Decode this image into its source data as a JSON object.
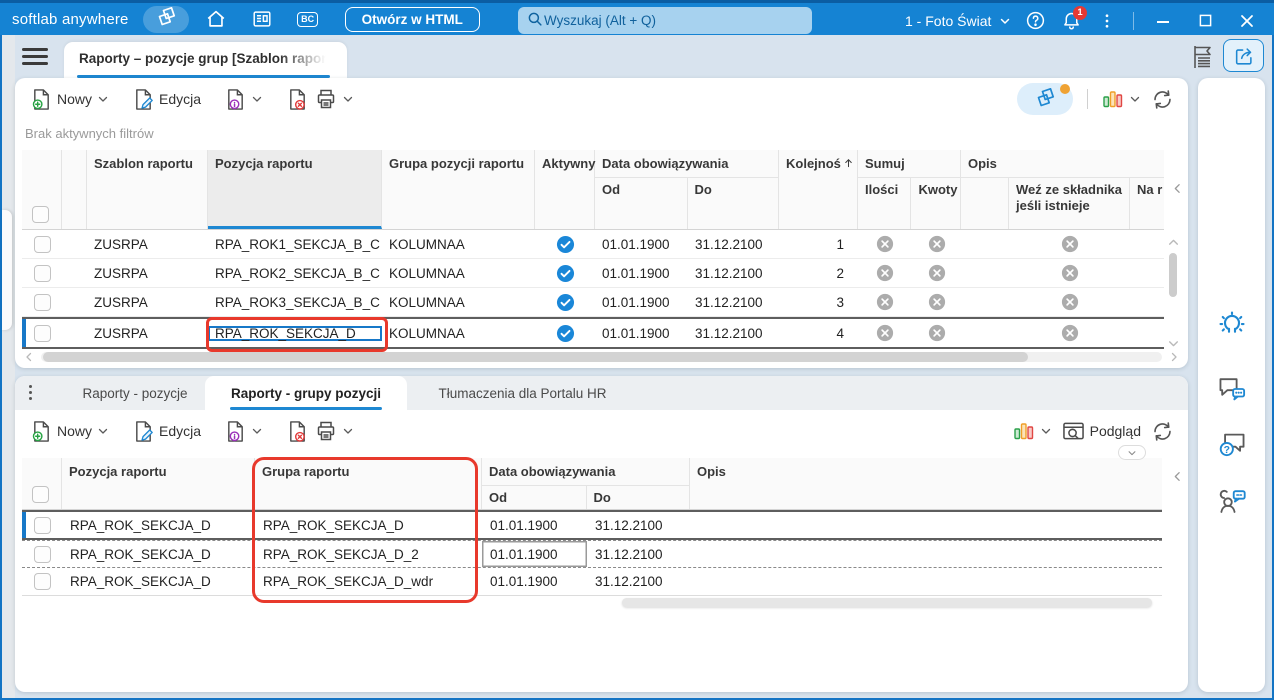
{
  "colors": {
    "titlebar_blue": "#1583d3",
    "accent_blue": "#1e88d2",
    "annotation_red": "#e8392c",
    "active_check_blue": "#1a87d8",
    "disabled_gray": "#acacac"
  },
  "titlebar": {
    "brand": "softlab anywhere",
    "bc_label": "BC",
    "open_html_button": "Otwórz w HTML",
    "search_placeholder": "Wyszukaj (Alt + Q)",
    "company_selector": "1 - Foto Świat",
    "notification_count": "1"
  },
  "workspace_tab": {
    "title": "Raporty – pozycje grup [Szablon rapor"
  },
  "top_toolbar": {
    "new": "Nowy",
    "edit": "Edycja"
  },
  "filter_status": "Brak aktywnych filtrów",
  "top_grid": {
    "columns": {
      "template": "Szablon raportu",
      "position": "Pozycja raportu",
      "group": "Grupa pozycji raportu",
      "active": "Aktywny",
      "validity": "Data obowiązywania",
      "from": "Od",
      "to": "Do",
      "order": "Kolejnoś",
      "sum": "Sumuj",
      "quantities": "Ilości",
      "amounts": "Kwoty",
      "description": "Opis",
      "take_from_component": "Weź ze składnika jeśli istnieje",
      "na_r": "Na r"
    },
    "rows": [
      {
        "template": "ZUSRPA",
        "position": "RPA_ROK1_SEKCJA_B_C",
        "group": "KOLUMNAA",
        "from": "01.01.1900",
        "to": "31.12.2100",
        "order": "1"
      },
      {
        "template": "ZUSRPA",
        "position": "RPA_ROK2_SEKCJA_B_C",
        "group": "KOLUMNAA",
        "from": "01.01.1900",
        "to": "31.12.2100",
        "order": "2"
      },
      {
        "template": "ZUSRPA",
        "position": "RPA_ROK3_SEKCJA_B_C",
        "group": "KOLUMNAA",
        "from": "01.01.1900",
        "to": "31.12.2100",
        "order": "3"
      },
      {
        "template": "ZUSRPA",
        "position": "RPA_ROK_SEKCJA_D",
        "group": "KOLUMNAA",
        "from": "01.01.1900",
        "to": "31.12.2100",
        "order": "4"
      }
    ]
  },
  "detail_tabs": {
    "items": [
      {
        "label": "Raporty - pozycje"
      },
      {
        "label": "Raporty - grupy pozycji"
      },
      {
        "label": "Tłumaczenia dla Portalu HR"
      }
    ]
  },
  "bottom_toolbar": {
    "new": "Nowy",
    "edit": "Edycja",
    "preview": "Podgląd"
  },
  "bottom_grid": {
    "columns": {
      "position": "Pozycja raportu",
      "group": "Grupa raportu",
      "validity": "Data obowiązywania",
      "from": "Od",
      "to": "Do",
      "description": "Opis"
    },
    "rows": [
      {
        "position": "RPA_ROK_SEKCJA_D",
        "group": "RPA_ROK_SEKCJA_D",
        "from": "01.01.1900",
        "to": "31.12.2100"
      },
      {
        "position": "RPA_ROK_SEKCJA_D",
        "group": "RPA_ROK_SEKCJA_D_2",
        "from": "01.01.1900",
        "to": "31.12.2100"
      },
      {
        "position": "RPA_ROK_SEKCJA_D",
        "group": "RPA_ROK_SEKCJA_D_wdr",
        "from": "01.01.1900",
        "to": "31.12.2100"
      }
    ]
  },
  "icons": {
    "workspaces": "overlapping-pages",
    "home": "house",
    "news": "newspaper",
    "search": "magnifier",
    "help": "question-circle",
    "notifications": "bell",
    "menu": "kebab-dots",
    "new_record": "document-plus",
    "edit_record": "document-pencil",
    "info_record": "document-info",
    "delete_record": "document-x",
    "print": "printer",
    "chart": "bar-chart",
    "refresh": "circular-arrows",
    "preview": "window-magnifier",
    "active_flag": "check-circle",
    "inactive_flag": "x-circle"
  }
}
